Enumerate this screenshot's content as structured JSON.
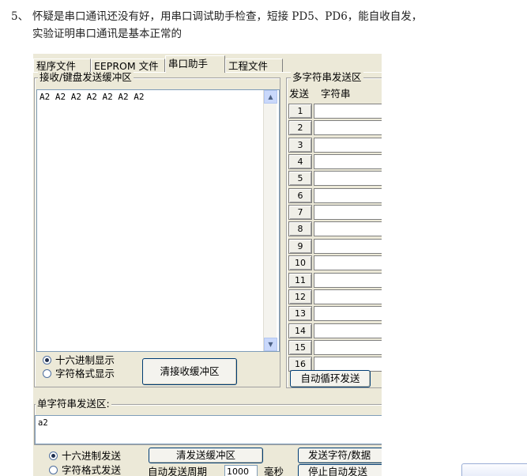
{
  "note": {
    "number": "5、",
    "line1": "怀疑是串口通讯还没有好，用串口调试助手检查，短接 PD5、PD6，能自收自发，",
    "line2": "实验证明串口通讯是基本正常的"
  },
  "tabs": [
    {
      "label": "程序文件",
      "active": false
    },
    {
      "label": "EEPROM 文件",
      "active": false
    },
    {
      "label": "串口助手",
      "active": true
    },
    {
      "label": "工程文件",
      "active": false
    }
  ],
  "receive": {
    "title": "接收/键盘发送缓冲区",
    "content": "A2 A2 A2 A2 A2 A2 A2",
    "radio_hex": "十六进制显示",
    "radio_char": "字符格式显示",
    "hex_selected": true,
    "clear_button": "清接收缓冲区"
  },
  "multi": {
    "title": "多字符串发送区",
    "col_send": "发送",
    "col_string": "字符串",
    "rows": [
      "1",
      "2",
      "3",
      "4",
      "5",
      "6",
      "7",
      "8",
      "9",
      "10",
      "11",
      "12",
      "13",
      "14",
      "15",
      "16"
    ],
    "auto_loop_button": "自动循环发送"
  },
  "single": {
    "title": "单字符串发送区:",
    "content": "a2",
    "radio_hex": "十六进制发送",
    "radio_char": "字符格式发送",
    "hex_selected": true,
    "clear_button": "清发送缓冲区",
    "send_button": "发送字符/数据",
    "auto_period_label": "自动发送周期",
    "auto_period_value": "1000",
    "unit": "毫秒",
    "stop_button": "停止自动发送"
  },
  "colors": {
    "window_bg": "#ece9d8",
    "field_border": "#7f9db9",
    "button_border": "#003c74"
  }
}
